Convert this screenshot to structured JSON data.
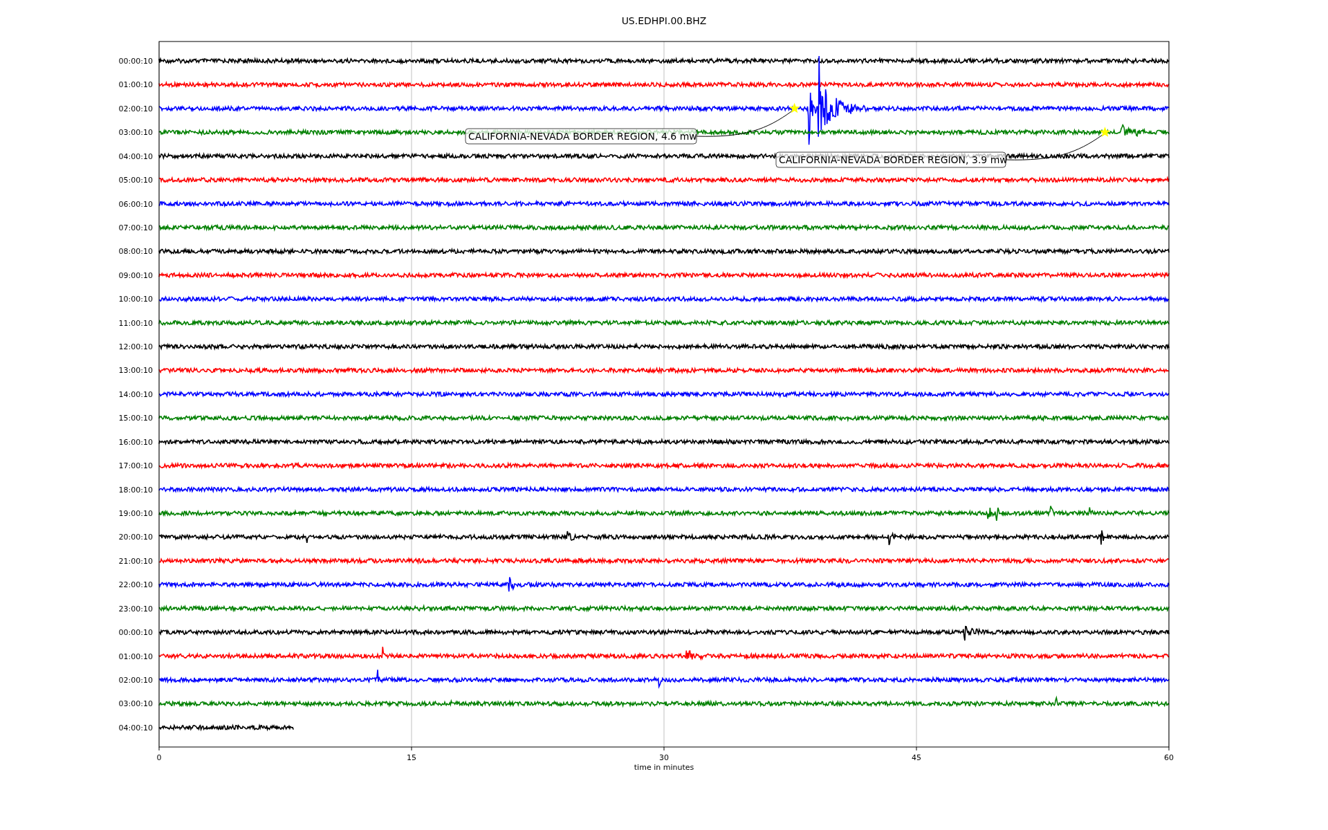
{
  "title": "US.EDHPI.00.BHZ",
  "rows": [
    {
      "label": "00:00:10",
      "color": "#000000",
      "level": 1
    },
    {
      "label": "01:00:10",
      "color": "#ff0000",
      "level": 1
    },
    {
      "label": "02:00:10",
      "color": "#0000ff",
      "level": 1
    },
    {
      "label": "03:00:10",
      "color": "#008000",
      "level": 1
    },
    {
      "label": "04:00:10",
      "color": "#000000",
      "level": 1
    },
    {
      "label": "05:00:10",
      "color": "#ff0000",
      "level": 1
    },
    {
      "label": "06:00:10",
      "color": "#0000ff",
      "level": 1
    },
    {
      "label": "07:00:10",
      "color": "#008000",
      "level": 1
    },
    {
      "label": "08:00:10",
      "color": "#000000",
      "level": 1
    },
    {
      "label": "09:00:10",
      "color": "#ff0000",
      "level": 1
    },
    {
      "label": "10:00:10",
      "color": "#0000ff",
      "level": 1
    },
    {
      "label": "11:00:10",
      "color": "#008000",
      "level": 1
    },
    {
      "label": "12:00:10",
      "color": "#000000",
      "level": 1
    },
    {
      "label": "13:00:10",
      "color": "#ff0000",
      "level": 1
    },
    {
      "label": "14:00:10",
      "color": "#0000ff",
      "level": 1
    },
    {
      "label": "15:00:10",
      "color": "#008000",
      "level": 1
    },
    {
      "label": "16:00:10",
      "color": "#000000",
      "level": 1
    },
    {
      "label": "17:00:10",
      "color": "#ff0000",
      "level": 1
    },
    {
      "label": "18:00:10",
      "color": "#0000ff",
      "level": 1
    },
    {
      "label": "19:00:10",
      "color": "#008000",
      "level": 1
    },
    {
      "label": "20:00:10",
      "color": "#000000",
      "level": 1
    },
    {
      "label": "21:00:10",
      "color": "#ff0000",
      "level": 1
    },
    {
      "label": "22:00:10",
      "color": "#0000ff",
      "level": 1
    },
    {
      "label": "23:00:10",
      "color": "#008000",
      "level": 1
    },
    {
      "label": "00:00:10",
      "color": "#000000",
      "level": 1
    },
    {
      "label": "01:00:10",
      "color": "#ff0000",
      "level": 1
    },
    {
      "label": "02:00:10",
      "color": "#0000ff",
      "level": 1
    },
    {
      "label": "03:00:10",
      "color": "#008000",
      "level": 1
    },
    {
      "label": "04:00:10",
      "color": "#000000",
      "level": 0.133
    }
  ],
  "x_ticks": [
    "0",
    "15",
    "30",
    "45",
    "60"
  ],
  "x_label": "time in minutes",
  "annotations": [
    {
      "text": "CALIFORNIA-NEVADA BORDER REGION, 4.6 mw"
    },
    {
      "text": "CALIFORNIA-NEVADA BORDER REGION, 3.9 mw"
    }
  ]
}
